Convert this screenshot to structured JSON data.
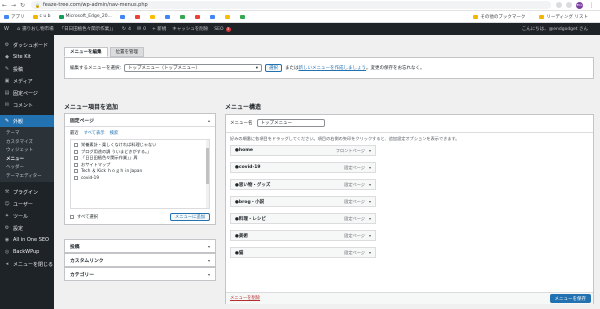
{
  "browser": {
    "url": "feaze-tree.com/wp-admin/nav-menus.php",
    "bookmarks": [
      {
        "label": "アプリ",
        "color": "#4285f4"
      },
      {
        "label": "c u b",
        "color": "#f4b400"
      },
      {
        "label": "Microsoft_Edge_20...",
        "color": "#0f9d58"
      },
      {
        "label": "",
        "color": "#4285f4"
      },
      {
        "label": "",
        "color": "#ea4335"
      },
      {
        "label": "",
        "color": "#fbbc05"
      },
      {
        "label": "",
        "color": "#4285f4"
      },
      {
        "label": "",
        "color": "#34a853"
      },
      {
        "label": "",
        "color": "#ea4335"
      },
      {
        "label": "",
        "color": "#4285f4"
      },
      {
        "label": "",
        "color": "#fbbc05"
      },
      {
        "label": "",
        "color": "#34a853"
      }
    ],
    "bookmarks_right": [
      "その他のブックマーク",
      "リーディング リスト"
    ],
    "avatar": "ECL"
  },
  "adminbar": {
    "items": [
      "揚りおし物市場",
      "「日日田植色々関示作業」」",
      "4",
      "0",
      "+ 新規",
      "キャッシュを削除",
      "SEO"
    ],
    "seo_count": "3",
    "greeting": "こんにちは、@endgodget さん"
  },
  "sidebar": {
    "items": [
      {
        "icon": "⚙",
        "label": "ダッシュボード"
      },
      {
        "icon": "◆",
        "label": "Site Kit"
      },
      {
        "icon": "✎",
        "label": "投稿"
      },
      {
        "icon": "▣",
        "label": "メディア"
      },
      {
        "icon": "▤",
        "label": "固定ページ"
      },
      {
        "icon": "✉",
        "label": "コメント"
      }
    ],
    "active": {
      "icon": "✎",
      "label": "外観"
    },
    "submenu": [
      "テーマ",
      "カスタマイズ",
      "ウィジェット",
      "メニュー",
      "ヘッダー",
      "テーマエディター"
    ],
    "submenu_current": 3,
    "items_after": [
      {
        "icon": "⚒",
        "label": "プラグイン"
      },
      {
        "icon": "☺",
        "label": "ユーザー"
      },
      {
        "icon": "✦",
        "label": "ツール"
      },
      {
        "icon": "⚙",
        "label": "設定"
      },
      {
        "icon": "◉",
        "label": "All in One SEO"
      },
      {
        "icon": "◎",
        "label": "BackWPup"
      },
      {
        "icon": "◂",
        "label": "メニューを閉じる"
      }
    ]
  },
  "tabs": [
    "メニューを編集",
    "位置を管理"
  ],
  "select_bar": {
    "label": "編集するメニューを選択:",
    "selected": "トップメニュー（トップメニュー）",
    "select_button": "選択",
    "or_text": "または",
    "create_link": "新しいメニューを作成しましょう",
    "tail": "。変更の保存をお忘れなく。"
  },
  "left": {
    "heading": "メニュー項目を追加",
    "pages_section": {
      "title": "固定ページ",
      "subtabs": [
        "最近",
        "すべて表示",
        "検索"
      ],
      "items": [
        "栄養素計・楽しくなければ料理じゃない",
        "ブログ用途の調 ういまどきがする。」",
        "「日日田植色々関示作業」」周",
        "おサイトマップ",
        "Tech ＆ Kick ｈｏｇｈ in Japan",
        "covid-19"
      ],
      "select_all": "すべて選択",
      "add_button": "メニューに追加"
    },
    "collapsed": [
      "投稿",
      "カスタムリンク",
      "カテゴリー"
    ]
  },
  "right": {
    "heading": "メニュー構造",
    "name_label": "メニュー名",
    "name_value": "トップメニュー",
    "help": "好みの順番に各項目をドラッグしてください。項目の右側の矢印をクリックすると、追加設定オプションを表示できます。",
    "items": [
      {
        "title": "●home",
        "type": "フロントページ"
      },
      {
        "title": "●covid-19",
        "type": "固定ページ"
      },
      {
        "title": "●思い物・グッズ",
        "type": "固定ページ"
      },
      {
        "title": "●brog・小説",
        "type": "固定ページ"
      },
      {
        "title": "●料理・レシピ",
        "type": "固定ページ"
      },
      {
        "title": "●美術",
        "type": "固定ページ"
      },
      {
        "title": "●猫",
        "type": "固定ページ"
      }
    ],
    "delete_link": "メニューを削除",
    "save_button": "メニューを保存"
  }
}
